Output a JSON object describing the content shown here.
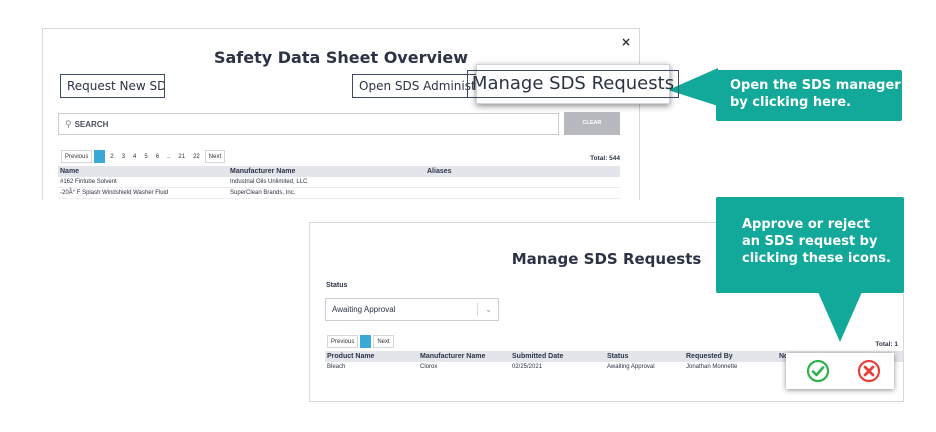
{
  "top_modal": {
    "title": "Safety Data Sheet Overview",
    "close_label": "×",
    "request_new_label": "Request New SDS",
    "open_admin_label": "Open SDS Administratio",
    "search_placeholder": "SEARCH",
    "clear_label": "CLEAR",
    "pager": {
      "previous": "Previous",
      "pages": [
        "1",
        "2",
        "3",
        "4",
        "5",
        "6",
        "..",
        "21",
        "22"
      ],
      "next": "Next"
    },
    "total": "Total: 544",
    "columns": [
      "Name",
      "Manufacturer Name",
      "Aliases"
    ],
    "rows": [
      [
        "#162 Fintube Solvent",
        "Industrial Oils Unlimited, LLC",
        ""
      ],
      [
        "-20Â° F Splash Windshield Washer Fluid",
        "SuperClean Brands, Inc.",
        ""
      ]
    ]
  },
  "zoom_callout": {
    "label": "Manage SDS Requests"
  },
  "tips": {
    "manager": "Open the SDS manager by clicking here.",
    "manager_lines": [
      "Open the SDS manager",
      "by clicking here."
    ],
    "approve_lines": [
      "Approve or reject",
      "an SDS request by",
      "clicking these icons."
    ]
  },
  "bottom_modal": {
    "title": "Manage SDS Requests",
    "status_label": "Status",
    "status_value": "Awaiting Approval",
    "pager": {
      "previous": "Previous",
      "pages": [
        "1"
      ],
      "next": "Next"
    },
    "total": "Total: 1",
    "columns": [
      "Product Name",
      "Manufacturer Name",
      "Submitted Date",
      "Status",
      "Requested By",
      "Not"
    ],
    "rows": [
      [
        "Bleach",
        "Clorox",
        "02/25/2021",
        "Awaiting Approval",
        "Jonathan Monnette",
        ""
      ]
    ]
  },
  "colors": {
    "teal": "#12a89a",
    "approve": "#2fb24a",
    "reject": "#e8413b",
    "pager_active": "#3aa9d8"
  }
}
